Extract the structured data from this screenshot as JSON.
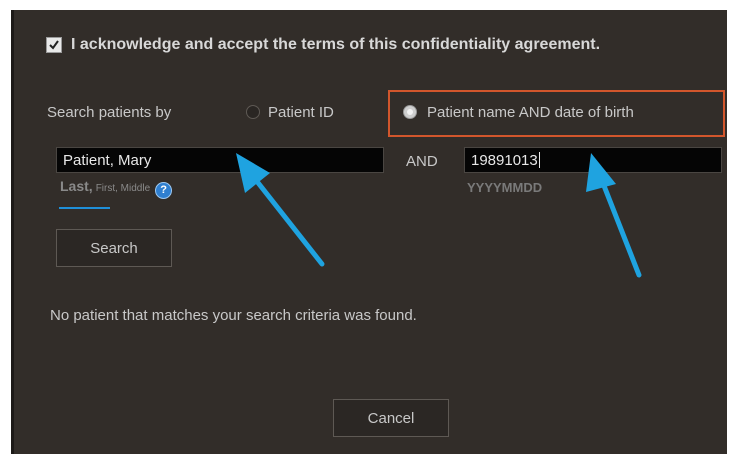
{
  "agreement": {
    "checked": true,
    "label": "I acknowledge and accept the terms of this confidentiality agreement."
  },
  "search_by": {
    "label": "Search patients by",
    "options": [
      {
        "label": "Patient ID",
        "selected": false
      },
      {
        "label": "Patient name AND date of birth",
        "selected": true
      }
    ]
  },
  "name_field": {
    "value": "Patient, Mary",
    "hint_last": "Last,",
    "hint_rest": "First, Middle",
    "help_icon": "?"
  },
  "and_label": "AND",
  "dob_field": {
    "value": "19891013",
    "hint": "YYYYMMDD"
  },
  "search_button": "Search",
  "result_message": "No patient that matches your search criteria was found.",
  "cancel_button": "Cancel",
  "colors": {
    "dialog_bg": "#322d29",
    "highlight": "#d2562c",
    "arrow": "#1fa3e0",
    "input_bg": "#050505"
  },
  "icons": {
    "checkbox": "checkmark-icon",
    "help": "help-circle-icon",
    "annotation": "arrow-icon"
  }
}
